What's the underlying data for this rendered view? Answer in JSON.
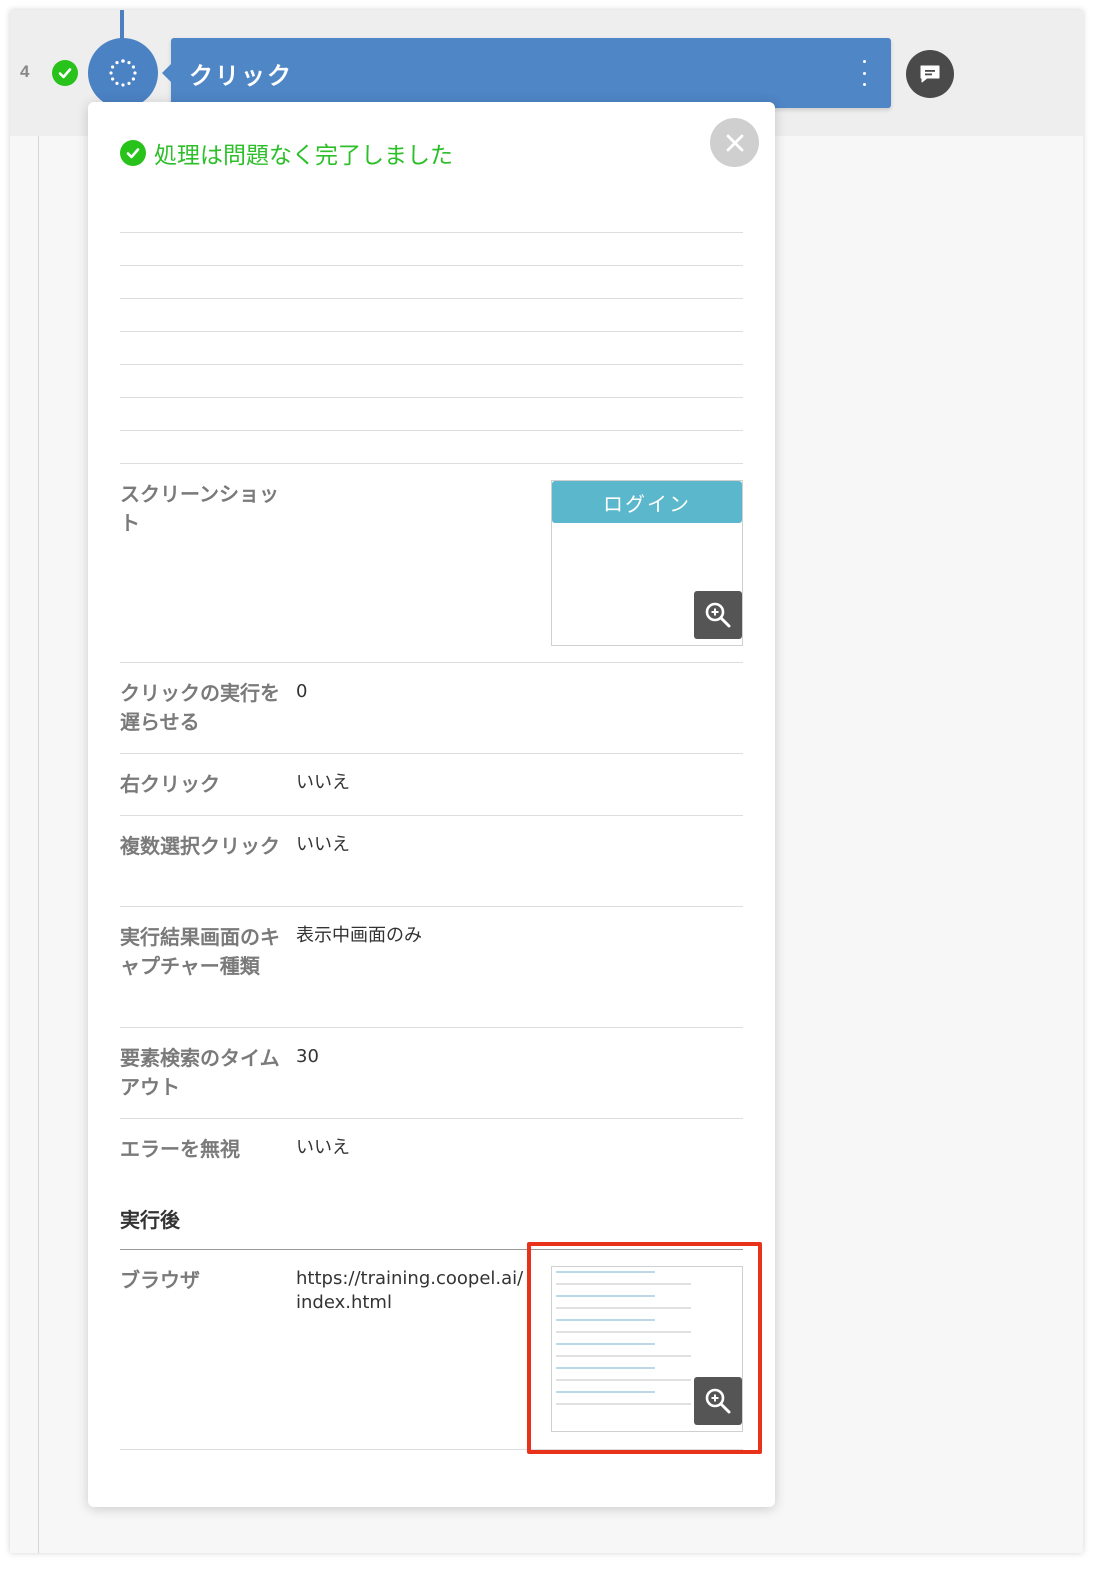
{
  "step": {
    "number": "4",
    "title": "クリック"
  },
  "panel": {
    "status_message": "処理は問題なく完了しました",
    "screenshot": {
      "label": "スクリーンショット",
      "thumbnail_button_text": "ログイン"
    },
    "properties": [
      {
        "label": "クリックの実行を遅らせる",
        "value": "0"
      },
      {
        "label": "右クリック",
        "value": "いいえ"
      },
      {
        "label": "複数選択クリック",
        "value": "いいえ"
      },
      {
        "label": "実行結果画面のキャプチャー種類",
        "value": "表示中画面のみ"
      },
      {
        "label": "要素検索のタイムアウト",
        "value": "30"
      },
      {
        "label": "エラーを無視",
        "value": "いいえ"
      }
    ],
    "after_section": {
      "heading": "実行後",
      "browser_label": "ブラウザ",
      "browser_url_line1": "https://training.coopel.ai/",
      "browser_url_line2": "index.html"
    }
  },
  "colors": {
    "step_blue": "#4f86c6",
    "success_green": "#27c21a",
    "highlight_red": "#e8321a",
    "login_button": "#5bb8cc"
  },
  "icons": [
    "check-circle-icon",
    "spinner-icon",
    "kebab-menu-icon",
    "comment-icon",
    "close-icon",
    "zoom-in-icon"
  ]
}
